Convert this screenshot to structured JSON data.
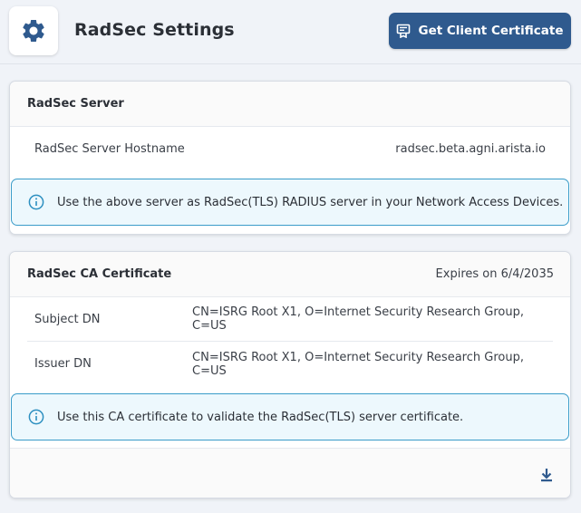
{
  "header": {
    "icon": "gear-icon",
    "title": "RadSec Settings",
    "get_cert_button": {
      "icon": "certificate-icon",
      "label": "Get Client Certificate"
    }
  },
  "server_card": {
    "title": "RadSec Server",
    "rows": [
      {
        "key": "RadSec Server Hostname",
        "value": "radsec.beta.agni.arista.io"
      }
    ],
    "info": {
      "icon": "info-icon",
      "text": "Use the above server as RadSec(TLS) RADIUS server in your Network Access Devices."
    }
  },
  "ca_card": {
    "title": "RadSec CA Certificate",
    "expires": "Expires on 6/4/2035",
    "rows": [
      {
        "key": "Subject DN",
        "value": "CN=ISRG Root X1, O=Internet Security Research Group, C=US"
      },
      {
        "key": "Issuer DN",
        "value": "CN=ISRG Root X1, O=Internet Security Research Group, C=US"
      }
    ],
    "info": {
      "icon": "info-icon",
      "text": "Use this CA certificate to validate the RadSec(TLS) server certificate."
    },
    "download_icon": "download-icon"
  },
  "colors": {
    "accent": "#2f5a8e",
    "info_border": "#3a9cc9",
    "info_background": "#edf8fd",
    "page_background": "#f0f3f8"
  }
}
